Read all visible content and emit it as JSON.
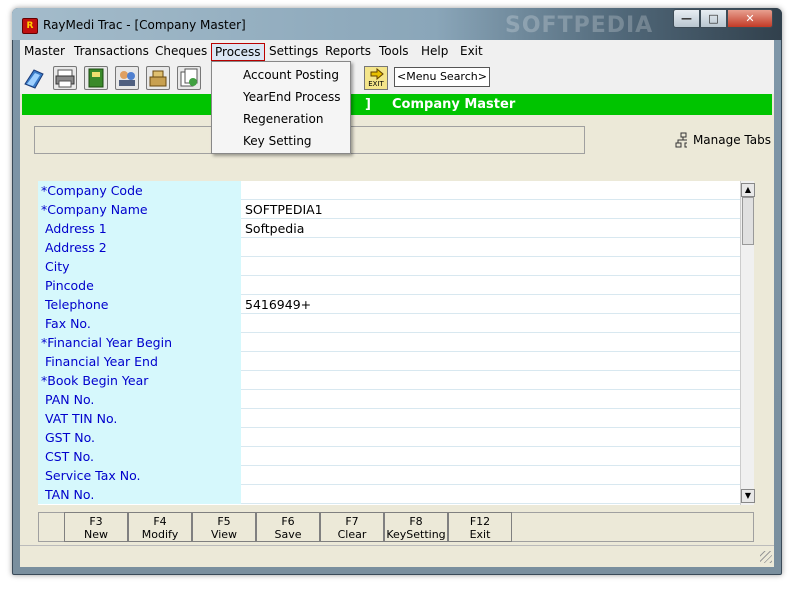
{
  "window": {
    "title": "RayMedi Trac - [Company Master]",
    "watermark": "SOFTPEDIA",
    "buttons": {
      "minimize": "—",
      "maximize": "□",
      "close": "✕"
    }
  },
  "menu": {
    "items": [
      "Master",
      "Transactions",
      "Cheques",
      "Process",
      "Settings",
      "Reports",
      "Tools",
      "Help",
      "Exit"
    ],
    "active": "Process"
  },
  "process_menu": {
    "items": [
      "Account Posting",
      "YearEnd Process",
      "Regeneration",
      "Key Setting"
    ]
  },
  "toolbar": {
    "search_label": "<Menu Search>",
    "exit_label": "EXIT",
    "icons": [
      "book-icon",
      "printer-icon",
      "binder-icon",
      "users-icon",
      "cash-register-icon",
      "documents-icon"
    ]
  },
  "banner": {
    "bracket": "]",
    "title": "Company Master"
  },
  "manage_tabs": {
    "label": "Manage Tabs"
  },
  "form": {
    "fields": [
      {
        "label": "*Company Code",
        "value": ""
      },
      {
        "label": "*Company Name",
        "value": "SOFTPEDIA1"
      },
      {
        "label": "Address 1",
        "value": "Softpedia"
      },
      {
        "label": "Address 2",
        "value": ""
      },
      {
        "label": "City",
        "value": ""
      },
      {
        "label": "Pincode",
        "value": ""
      },
      {
        "label": "Telephone",
        "value": "5416949+"
      },
      {
        "label": "Fax No.",
        "value": ""
      },
      {
        "label": "*Financial Year Begin",
        "value": ""
      },
      {
        "label": "Financial Year End",
        "value": ""
      },
      {
        "label": "*Book Begin Year",
        "value": ""
      },
      {
        "label": "PAN No.",
        "value": ""
      },
      {
        "label": "VAT TIN No.",
        "value": ""
      },
      {
        "label": "GST No.",
        "value": ""
      },
      {
        "label": "CST No.",
        "value": ""
      },
      {
        "label": "Service Tax No.",
        "value": ""
      },
      {
        "label": "TAN No.",
        "value": ""
      }
    ]
  },
  "function_keys": [
    {
      "key": "F3",
      "label": "New"
    },
    {
      "key": "F4",
      "label": "Modify"
    },
    {
      "key": "F5",
      "label": "View"
    },
    {
      "key": "F6",
      "label": "Save"
    },
    {
      "key": "F7",
      "label": "Clear"
    },
    {
      "key": "F8",
      "label": "KeySetting"
    },
    {
      "key": "F12",
      "label": "Exit"
    }
  ],
  "colors": {
    "banner": "#00c400",
    "label_bg": "#d6f8fc",
    "label_text": "#0000cc"
  }
}
